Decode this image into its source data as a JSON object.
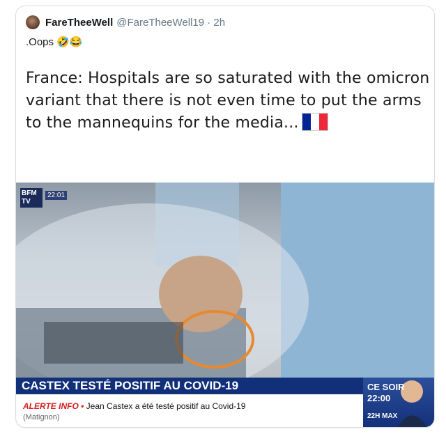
{
  "tweet": {
    "display_name": "FareTheeWell",
    "handle_time": "@FareTheeWell19 · 2h",
    "text": ".Oops 🤣😂",
    "headline": "France: Hospitals are so saturated with the omicron variant that there is not even time to put the arms to the mannequins for the media..."
  },
  "broadcast": {
    "channel_logo": "BFM TV",
    "channel_time": "22:01",
    "banner": "CASTEX TESTÉ POSITIF AU COVID-19",
    "alert_label": "ALERTE INFO •",
    "alert_text": "Jean Castex a été testé positif au Covid-19",
    "alert_location": "(Matignon)",
    "side_line1": "CE SOIR",
    "side_line2": "22:00",
    "side_line3": "22H MAX"
  },
  "colors": {
    "flag": [
      "#002395",
      "#ffffff",
      "#ed2939"
    ],
    "annotation_circle": "#e8892f"
  }
}
